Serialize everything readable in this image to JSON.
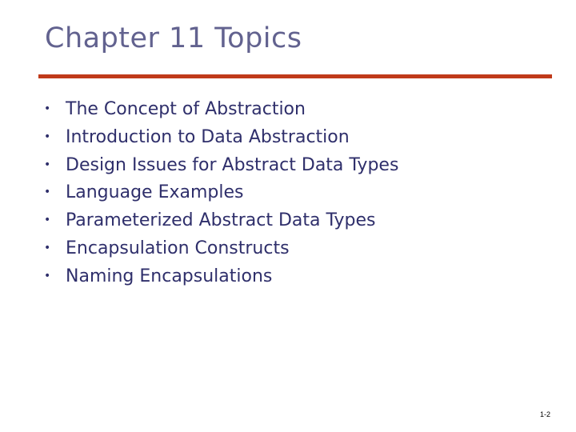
{
  "slide": {
    "title": "Chapter 11 Topics",
    "bullets": [
      "The Concept of Abstraction",
      "Introduction to Data Abstraction",
      "Design Issues for Abstract Data Types",
      "Language Examples",
      "Parameterized Abstract Data Types",
      "Encapsulation Constructs",
      "Naming Encapsulations"
    ],
    "bullet_glyph": "•",
    "page_number": "1-2"
  },
  "colors": {
    "title": "#62628f",
    "body_text": "#2f2f6b",
    "rule": "#c03a1a"
  }
}
